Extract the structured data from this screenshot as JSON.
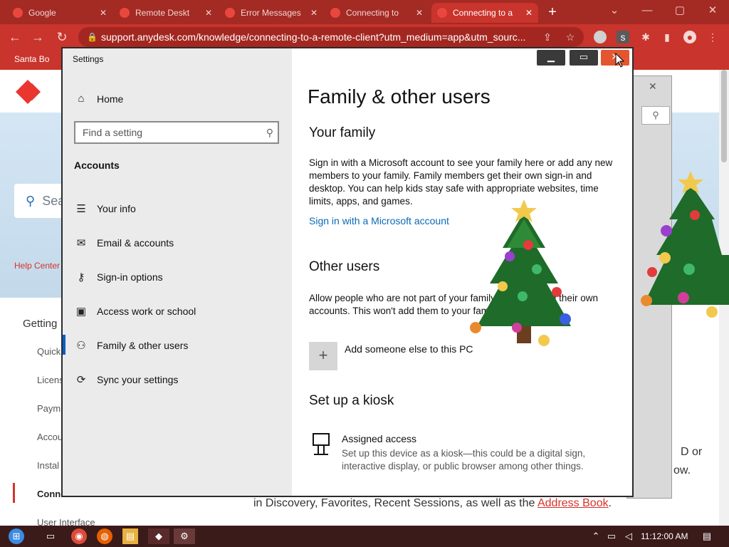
{
  "browser": {
    "tabs": [
      {
        "title": "Google",
        "active": false
      },
      {
        "title": "Remote Deskt",
        "active": false
      },
      {
        "title": "Error Messages",
        "active": false
      },
      {
        "title": "Connecting to",
        "active": false
      },
      {
        "title": "Connecting to a",
        "active": true
      }
    ],
    "url": "support.anydesk.com/knowledge/connecting-to-a-remote-client?utm_medium=app&utm_sourc...",
    "bookmark": "Santa Bo",
    "extension_badge": "s",
    "window_controls": {
      "minimize": "—",
      "maximize": "▢",
      "close": "✕"
    }
  },
  "webpage": {
    "search_placeholder": "Sea",
    "help_center": "Help Center",
    "getting": "Getting",
    "side_items": [
      "Quick",
      "Licens",
      "Paym",
      "Accou",
      "Instal",
      "Conne",
      "User Interface"
    ],
    "right_text_1": "D or",
    "right_text_2": "ow.",
    "body_prefix": "in Discovery, Favorites, Recent Sessions, as well as the ",
    "body_link": "Address Book",
    "body_suffix": "."
  },
  "settings": {
    "window_title": "Settings",
    "home_label": "Home",
    "search_placeholder": "Find a setting",
    "section_heading": "Accounts",
    "nav_items": [
      {
        "label": "Your info",
        "icon": "person-card-icon"
      },
      {
        "label": "Email & accounts",
        "icon": "envelope-icon"
      },
      {
        "label": "Sign-in options",
        "icon": "key-icon"
      },
      {
        "label": "Access work or school",
        "icon": "briefcase-icon"
      },
      {
        "label": "Family & other users",
        "icon": "people-icon",
        "selected": true
      },
      {
        "label": "Sync your settings",
        "icon": "sync-icon"
      }
    ],
    "page_title": "Family & other users",
    "your_family": {
      "heading": "Your family",
      "text": "Sign in with a Microsoft account to see your family here or add any new members to your family. Family members get their own sign-in and desktop. You can help kids stay safe with appropriate websites, time limits, apps, and games.",
      "link": "Sign in with a Microsoft account"
    },
    "other_users": {
      "heading": "Other users",
      "text": "Allow people who are not part of your family to sign in with their own accounts. This won't add them to your family.",
      "add_label": "Add someone else to this PC"
    },
    "kiosk": {
      "heading": "Set up a kiosk",
      "title": "Assigned access",
      "description": "Set up this device as a kiosk—this could be a digital sign, interactive display, or public browser among other things."
    }
  },
  "taskbar": {
    "clock": "11:12:00 AM"
  }
}
